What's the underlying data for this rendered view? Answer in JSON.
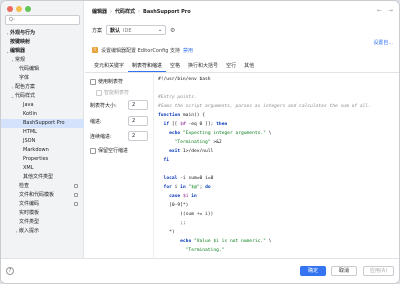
{
  "sidebar": {
    "search_placeholder": "Q-",
    "items": [
      {
        "label": "外观与行为",
        "chev": "›",
        "bold": true
      },
      {
        "label": "按键映射",
        "chev": "",
        "bold": true
      },
      {
        "label": "编辑器",
        "chev": "⌄",
        "bold": true
      },
      {
        "label": "常规",
        "chev": "›",
        "bold": false
      },
      {
        "label": "代码编辑",
        "chev": "",
        "bold": false
      },
      {
        "label": "字体",
        "chev": "",
        "bold": false
      },
      {
        "label": "配色方案",
        "chev": "›",
        "bold": false
      },
      {
        "label": "代码样式",
        "chev": "⌄",
        "bold": false
      },
      {
        "label": "Java",
        "chev": "",
        "bold": false
      },
      {
        "label": "Kotlin",
        "chev": "",
        "bold": false
      },
      {
        "label": "BashSupport Pro",
        "chev": "",
        "bold": false,
        "selected": true
      },
      {
        "label": "HTML",
        "chev": "",
        "bold": false
      },
      {
        "label": "JSON",
        "chev": "",
        "bold": false
      },
      {
        "label": "Markdown",
        "chev": "",
        "bold": false
      },
      {
        "label": "Properties",
        "chev": "",
        "bold": false
      },
      {
        "label": "XML",
        "chev": "",
        "bold": false
      },
      {
        "label": "其他文件类型",
        "chev": "",
        "bold": false
      },
      {
        "label": "检查",
        "chev": "",
        "bold": false,
        "badge": true
      },
      {
        "label": "文件和代码模板",
        "chev": "",
        "bold": false,
        "badge": true
      },
      {
        "label": "文件编码",
        "chev": "",
        "bold": false,
        "badge": true
      },
      {
        "label": "实时模板",
        "chev": "",
        "bold": false
      },
      {
        "label": "文件类型",
        "chev": "",
        "bold": false
      },
      {
        "label": "嵌入提示",
        "chev": "›",
        "bold": false
      }
    ]
  },
  "breadcrumb": {
    "a": "编辑器",
    "b": "代码样式",
    "c": "BashSupport Pro",
    "sep": "›"
  },
  "nav": {
    "back": "←",
    "forward": "→"
  },
  "scheme": {
    "label": "方案",
    "value": "默认",
    "ide": "IDE",
    "arrow": "⌄",
    "gear": "⚙"
  },
  "set_from": "设置自...",
  "warning": {
    "text": "设置编辑器配置 EditorConfig 支持",
    "link": "禁用"
  },
  "tabs": [
    "变元和关键字",
    "制表符和缩进",
    "空格",
    "换行和大括号",
    "空行",
    "其他"
  ],
  "options": {
    "use_tab": "使用制表符",
    "smart_tab": "智能制表符",
    "tab_size_label": "制表符大小:",
    "tab_size": "2",
    "indent_label": "缩进:",
    "indent": "2",
    "cont_indent_label": "连续缩进:",
    "cont_indent": "2",
    "keep_indent": "保留空行缩进"
  },
  "code": [
    [
      [
        "tx",
        "#!/usr/bin/env bash"
      ]
    ],
    [],
    [
      [
        "cm",
        "#Entry points."
      ]
    ],
    [
      [
        "cm",
        "#Sums the script arguments, parses as integers and calculates the sum of all."
      ]
    ],
    [
      [
        "kw",
        "function"
      ],
      [
        "tx",
        " main() {"
      ]
    ],
    [
      [
        "tx",
        "  "
      ],
      [
        "kw",
        "if"
      ],
      [
        "tx",
        " [[ "
      ],
      [
        "va",
        "$#"
      ],
      [
        "tx",
        " -eq 0 ]]; "
      ],
      [
        "kw",
        "then"
      ]
    ],
    [
      [
        "tx",
        "    "
      ],
      [
        "kw",
        "echo"
      ],
      [
        "st",
        " \"Expecting integer arguments.\""
      ],
      [
        "tx",
        " \\"
      ]
    ],
    [
      [
        "st",
        "      \"Terminating\""
      ],
      [
        "tx",
        " >&2"
      ]
    ],
    [
      [
        "tx",
        "    "
      ],
      [
        "kw",
        "exit"
      ],
      [
        "tx",
        " 1>/dev/null"
      ]
    ],
    [
      [
        "kw",
        "  fi"
      ]
    ],
    [],
    [
      [
        "tx",
        "  "
      ],
      [
        "kw",
        "local"
      ],
      [
        "tx",
        " -i sum=0 i=0"
      ]
    ],
    [
      [
        "tx",
        "  "
      ],
      [
        "kw",
        "for"
      ],
      [
        "tx",
        " i "
      ],
      [
        "kw",
        "in"
      ],
      [
        "st",
        " \"$@\""
      ],
      [
        "tx",
        "; "
      ],
      [
        "kw",
        "do"
      ]
    ],
    [
      [
        "tx",
        "    "
      ],
      [
        "kw",
        "case"
      ],
      [
        "tx",
        " "
      ],
      [
        "va",
        "$i"
      ],
      [
        "tx",
        " "
      ],
      [
        "kw",
        "in"
      ]
    ],
    [
      [
        "tx",
        "    [0-9]*)"
      ]
    ],
    [
      [
        "tx",
        "        ((sum += i))"
      ]
    ],
    [
      [
        "tx",
        "        ;;"
      ]
    ],
    [
      [
        "tx",
        "    *)"
      ]
    ],
    [
      [
        "tx",
        "        "
      ],
      [
        "kw",
        "echo"
      ],
      [
        "st",
        " \"Value $i is not numeric.\""
      ],
      [
        "tx",
        " \\"
      ]
    ],
    [
      [
        "st",
        "          \"Terminating.\""
      ]
    ]
  ],
  "footer": {
    "help": "?",
    "ok": "确定",
    "cancel": "取消",
    "apply": "应用(A)"
  }
}
